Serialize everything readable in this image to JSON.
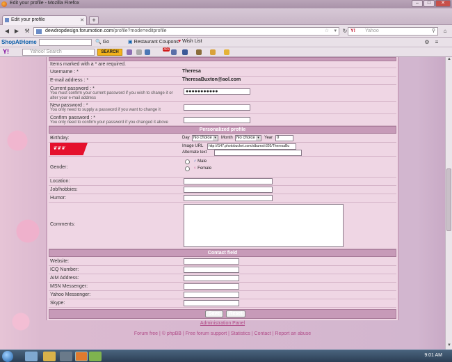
{
  "window": {
    "title": "Edit your profile - Mozilla Firefox"
  },
  "tabs": [
    {
      "label": "Edit your profile"
    }
  ],
  "nav": {
    "url_domain": "dewdropdesign.forumotion.com",
    "url_path": "/profile?mode=editprofile",
    "search_placeholder": "Yahoo"
  },
  "toolbar1": {
    "brand": "ShopAtHome",
    "go": "Go",
    "restaurant": "Restaurant Coupons",
    "wishlist": "Wish List"
  },
  "toolbar2": {
    "search_placeholder": "Yahoo! Search",
    "search_btn": "SEARCH",
    "badge": "301"
  },
  "form": {
    "required_note": "Items marked with a * are required.",
    "username_label": "Username : *",
    "username_value": "Theresa",
    "email_label": "E-mail address : *",
    "email_value": "TheresaBuxton@aol.com",
    "current_pw_label": "Current password : *",
    "current_pw_sub": "You must confirm your current password if you wish to change it or alter your e-mail address",
    "current_pw_value": "●●●●●●●●●●●",
    "new_pw_label": "New password : *",
    "new_pw_sub": "You only need to supply a password if you want to change it",
    "confirm_pw_label": "Confirm password : *",
    "confirm_pw_sub": "You only need to confirm your password if you changed it above",
    "personalized_header": "Personalized profile",
    "birthday_label": "Birthday:",
    "day_label": "Day",
    "day_value": "No choice",
    "month_label": "Month",
    "month_value": "No choice",
    "year_label": "Year",
    "year_value": "0",
    "image_url_label": "Image URL",
    "image_url_value": "http://i147.photobucket.com/albums/r320/TheresaBu",
    "alt_text_label": "Alternate text",
    "gender_label": "Gender:",
    "male_label": "Male",
    "female_label": "Female",
    "location_label": "Location:",
    "job_label": "Job/hobbies:",
    "humor_label": "Humor:",
    "comments_label": "Comments:",
    "contact_header": "Contact field",
    "website_label": "Website:",
    "icq_label": "ICQ Number:",
    "aim_label": "AIM Address:",
    "msn_label": "MSN Messenger:",
    "yahoo_label": "Yahoo Messenger:",
    "skype_label": "Skype:",
    "save_btn": "Save",
    "reset_btn": "Reset"
  },
  "footer": {
    "admin_panel": "Administration Panel",
    "links": "Forum free | © phpBB | Free forum support | Statistics | Contact | Report an abuse"
  },
  "taskbar": {
    "time": "9:01 AM"
  }
}
